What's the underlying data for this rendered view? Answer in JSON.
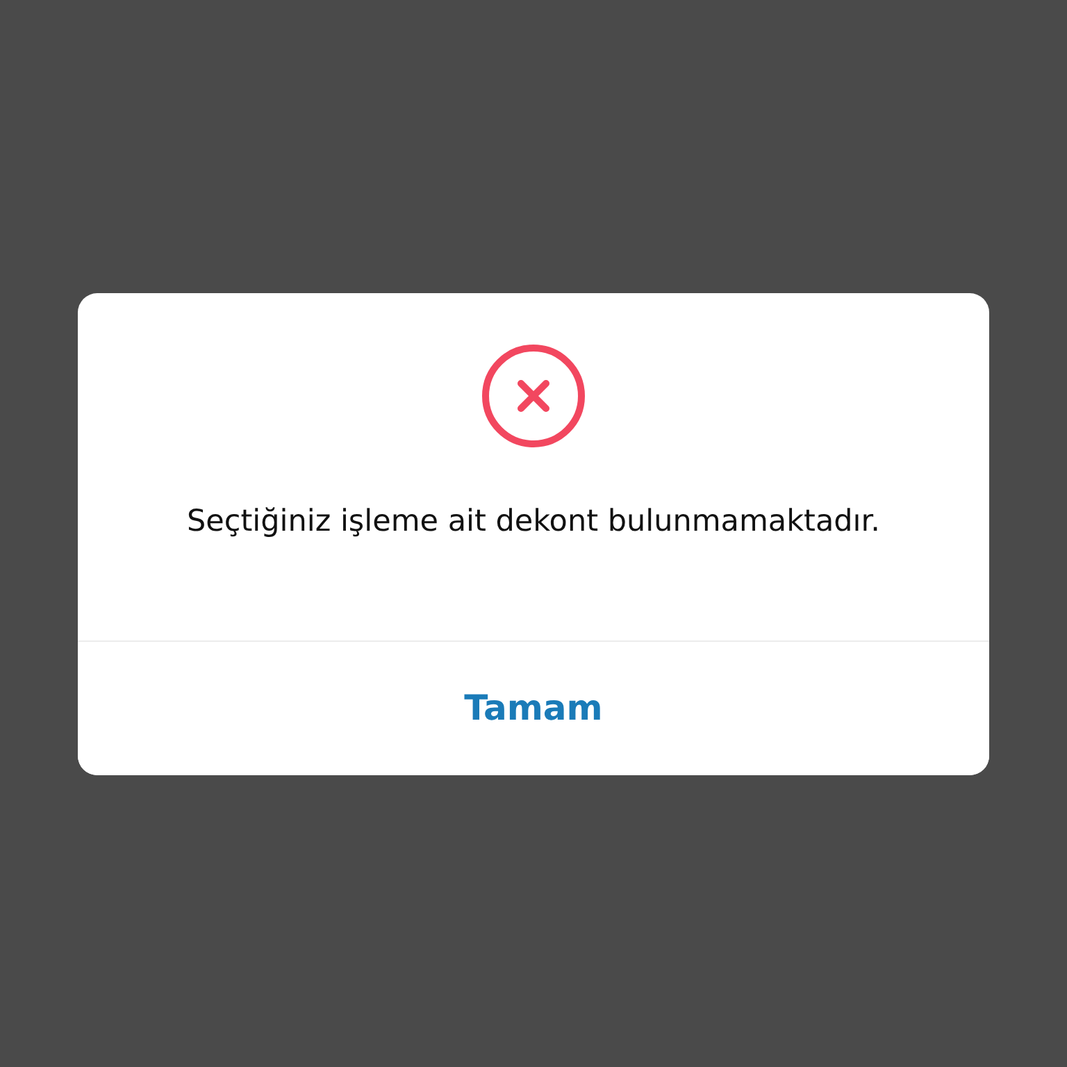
{
  "dialog": {
    "message": "Seçtiğiniz işleme ait dekont bulunmamaktadır.",
    "buttons": [
      {
        "label": "Tamam"
      }
    ]
  }
}
